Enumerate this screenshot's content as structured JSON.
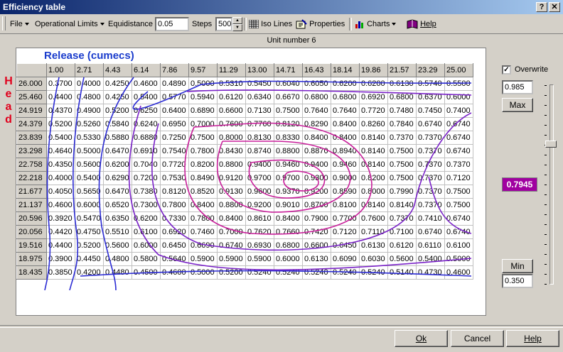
{
  "window": {
    "title": "Efficiency table"
  },
  "toolbar": {
    "file": "File",
    "operational_limits": "Operational Limits",
    "equidistance_label": "Equidistance",
    "equidistance_value": "0.05",
    "steps_label": "Steps",
    "steps_value": "500",
    "iso_lines": "Iso Lines",
    "properties": "Properties",
    "charts": "Charts",
    "help": "Help"
  },
  "unit_label": "Unit number 6",
  "axis": {
    "release": "Release (cumecs)",
    "head": "Head"
  },
  "columns": [
    "1.00",
    "2.71",
    "4.43",
    "6.14",
    "7.86",
    "9.57",
    "11.29",
    "13.00",
    "14.71",
    "16.43",
    "18.14",
    "19.86",
    "21.57",
    "23.29",
    "25.00"
  ],
  "rows": [
    {
      "head": "26.000",
      "v": [
        "0.3700",
        "0.4000",
        "0.4250",
        "0.4600",
        "0.4890",
        "0.5000",
        "0.5310",
        "0.5450",
        "0.6040",
        "0.6050",
        "0.6200",
        "0.6200",
        "0.6130",
        "0.5740",
        "0.5500"
      ]
    },
    {
      "head": "25.460",
      "v": [
        "0.4400",
        "0.4800",
        "0.4250",
        "0.5400",
        "0.5770",
        "0.5940",
        "0.6120",
        "0.6340",
        "0.6670",
        "0.6800",
        "0.6800",
        "0.6920",
        "0.6800",
        "0.6370",
        "0.6000"
      ]
    },
    {
      "head": "24.919",
      "v": [
        "0.4370",
        "0.4900",
        "0.5200",
        "0.6250",
        "0.6400",
        "0.6890",
        "0.6600",
        "0.7130",
        "0.7500",
        "0.7640",
        "0.7640",
        "0.7720",
        "0.7480",
        "0.7450",
        "0.7400"
      ]
    },
    {
      "head": "24.379",
      "v": [
        "0.5200",
        "0.5260",
        "0.5840",
        "0.6240",
        "0.6950",
        "0.7000",
        "0.7600",
        "0.7760",
        "0.8120",
        "0.8290",
        "0.8400",
        "0.8260",
        "0.7840",
        "0.6740",
        "0.6740"
      ]
    },
    {
      "head": "23.839",
      "v": [
        "0.5400",
        "0.5330",
        "0.5880",
        "0.6880",
        "0.7250",
        "0.7500",
        "0.8000",
        "0.8130",
        "0.8330",
        "0.8400",
        "0.8400",
        "0.8140",
        "0.7370",
        "0.7370",
        "0.6740"
      ]
    },
    {
      "head": "23.298",
      "v": [
        "0.4640",
        "0.5000",
        "0.6470",
        "0.6910",
        "0.7540",
        "0.7800",
        "0.8430",
        "0.8740",
        "0.8800",
        "0.8870",
        "0.8940",
        "0.8140",
        "0.7500",
        "0.7370",
        "0.6740"
      ]
    },
    {
      "head": "22.758",
      "v": [
        "0.4350",
        "0.5600",
        "0.6200",
        "0.7040",
        "0.7720",
        "0.8200",
        "0.8800",
        "0.9400",
        "0.9460",
        "0.9400",
        "0.9460",
        "0.8140",
        "0.7500",
        "0.7370",
        "0.7370"
      ]
    },
    {
      "head": "22.218",
      "v": [
        "0.4000",
        "0.5400",
        "0.6290",
        "0.7200",
        "0.7530",
        "0.8490",
        "0.9120",
        "0.9700",
        "0.9700",
        "0.9300",
        "0.9000",
        "0.8200",
        "0.7500",
        "0.7370",
        "0.7120"
      ]
    },
    {
      "head": "21.677",
      "v": [
        "0.4050",
        "0.5650",
        "0.6470",
        "0.7380",
        "0.8120",
        "0.8520",
        "0.9130",
        "0.9600",
        "0.9370",
        "0.9200",
        "0.8590",
        "0.8000",
        "0.7990",
        "0.7370",
        "0.7500"
      ]
    },
    {
      "head": "21.137",
      "v": [
        "0.4600",
        "0.6000",
        "0.6520",
        "0.7300",
        "0.7800",
        "0.8400",
        "0.8800",
        "0.9200",
        "0.9010",
        "0.8700",
        "0.8100",
        "0.8140",
        "0.8140",
        "0.7370",
        "0.7500"
      ]
    },
    {
      "head": "20.596",
      "v": [
        "0.3920",
        "0.5470",
        "0.6350",
        "0.6200",
        "0.7330",
        "0.7800",
        "0.8400",
        "0.8610",
        "0.8400",
        "0.7900",
        "0.7700",
        "0.7600",
        "0.7370",
        "0.7410",
        "0.6740"
      ]
    },
    {
      "head": "20.056",
      "v": [
        "0.4420",
        "0.4750",
        "0.5510",
        "0.6100",
        "0.6920",
        "0.7460",
        "0.7000",
        "0.7620",
        "0.7660",
        "0.7420",
        "0.7120",
        "0.7110",
        "0.7100",
        "0.6740",
        "0.6740"
      ]
    },
    {
      "head": "19.516",
      "v": [
        "0.4400",
        "0.5200",
        "0.5600",
        "0.6000",
        "0.6450",
        "0.6690",
        "0.6740",
        "0.6930",
        "0.6800",
        "0.6600",
        "0.6450",
        "0.6130",
        "0.6120",
        "0.6110",
        "0.6100"
      ]
    },
    {
      "head": "18.975",
      "v": [
        "0.3900",
        "0.4450",
        "0.4800",
        "0.5800",
        "0.5640",
        "0.5900",
        "0.5900",
        "0.5900",
        "0.6000",
        "0.6130",
        "0.6090",
        "0.6030",
        "0.5600",
        "0.5400",
        "0.5000"
      ]
    },
    {
      "head": "18.435",
      "v": [
        "0.3850",
        "0.4200",
        "0.4480",
        "0.4500",
        "0.4600",
        "0.5000",
        "0.5200",
        "0.5240",
        "0.5240",
        "0.5240",
        "0.5240",
        "0.5240",
        "0.5140",
        "0.4730",
        "0.4600"
      ]
    }
  ],
  "right_panel": {
    "overwrite_label": "Overwrite",
    "overwrite_mark": "✓",
    "max_value": "0.985",
    "max_button": "Max",
    "current_value": "0.7945",
    "min_button": "Min",
    "min_value": "0.350"
  },
  "buttons": {
    "ok": "Ok",
    "cancel": "Cancel",
    "help": "Help"
  },
  "colors": {
    "low_iso": "#2b2bd4",
    "mid_iso": "#7a22c8",
    "high_iso": "#c81e9a",
    "highlight": "#a000a0"
  }
}
